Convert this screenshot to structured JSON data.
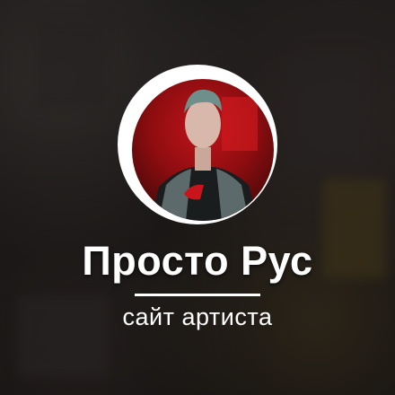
{
  "profile": {
    "name": "Просто Рус",
    "subtitle": "сайт артиста"
  },
  "colors": {
    "background": "#151313",
    "accent_red": "#c0141a",
    "text": "#ffffff"
  }
}
